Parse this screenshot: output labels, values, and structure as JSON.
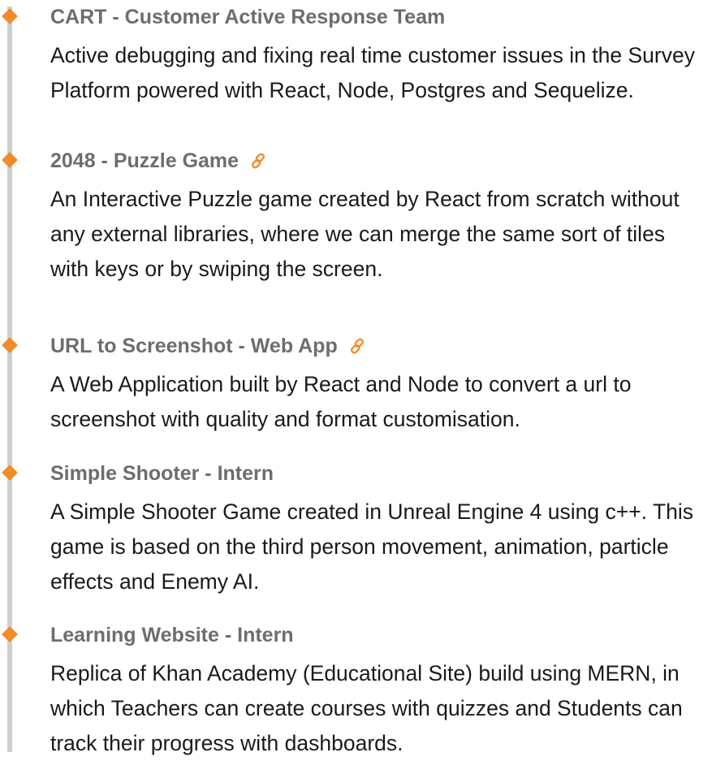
{
  "accent_color": "#f28b2a",
  "timeline": {
    "items": [
      {
        "title": "CART - Customer Active Response Team",
        "description": "Active debugging and fixing real time customer issues in the Survey Platform powered with React, Node, Postgres and Sequelize.",
        "has_link": false
      },
      {
        "title": "2048 - Puzzle Game",
        "description": "An Interactive Puzzle game created by React from scratch without any external libraries, where we can merge the same sort of tiles with keys or by swiping the screen.",
        "has_link": true,
        "link_icon": "link-icon"
      },
      {
        "title": "URL to Screenshot - Web App",
        "description": "A Web Application built by React and Node to convert a url to screenshot with quality and format customisation.",
        "has_link": true,
        "link_icon": "link-icon"
      },
      {
        "title": "Simple Shooter - Intern",
        "description": "A Simple Shooter Game created in Unreal Engine 4 using c++. This game is based on the third person movement, animation, particle effects and Enemy AI.",
        "has_link": false
      },
      {
        "title": "Learning Website - Intern",
        "description": "Replica of Khan Academy (Educational Site) build using MERN, in which Teachers can create courses with quizzes and Students can track their progress with dashboards.",
        "has_link": false
      }
    ]
  }
}
